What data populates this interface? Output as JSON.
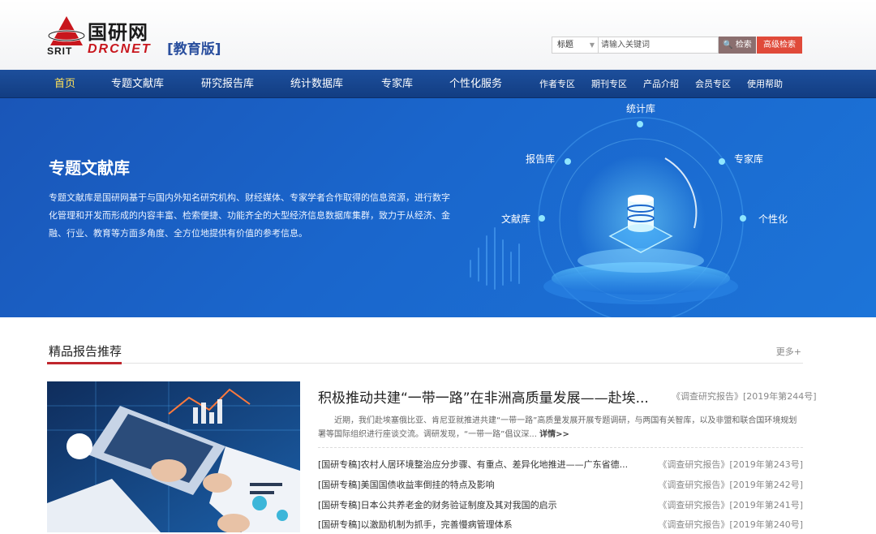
{
  "brand": {
    "name_cn": "国研网",
    "srit": "SRIT",
    "drcnet": "DRCNET",
    "edition": "[教育版]",
    "colors": {
      "brand_red": "#c8161d",
      "nav_blue": "#1a4a95",
      "edition_blue": "#2a4f9e"
    }
  },
  "search": {
    "field_select": "标题",
    "placeholder": "请输入关键词",
    "search_label": "检索",
    "advanced_label": "高级检索"
  },
  "nav": {
    "main": [
      "首页",
      "专题文献库",
      "研究报告库",
      "统计数据库",
      "专家库",
      "个性化服务"
    ],
    "secondary": [
      "作者专区",
      "期刊专区",
      "产品介绍",
      "会员专区",
      "使用帮助"
    ],
    "active_color": "#ffe25a"
  },
  "banner": {
    "title": "专题文献库",
    "description": "专题文献库是国研网基于与国内外知名研究机构、财经媒体、专家学者合作取得的信息资源，进行数字化管理和开发而形成的内容丰富、检索便捷、功能齐全的大型经济信息数据库集群，致力于从经济、金融、行业、教育等方面多角度、全方位地提供有价值的参考信息。",
    "hub_labels": {
      "top": "统计库",
      "upper_left": "报告库",
      "upper_right": "专家库",
      "left": "文献库",
      "right": "个性化"
    }
  },
  "section": {
    "title": "精品报告推荐",
    "more": "更多+"
  },
  "featured": {
    "title": "积极推动共建“一带一路”在非洲高质量发展——赴埃...",
    "source": "《调查研究报告》[2019年第244号]",
    "summary": "近期，我们赴埃塞俄比亚、肯尼亚就推进共建“一带一路”高质量发展开展专题调研，与两国有关智库，以及非盟和联合国环境规划署等国际组织进行座谈交流。调研发现，“一带一路”倡议深...",
    "more": "详情>>"
  },
  "reports": [
    {
      "title": "[国研专稿]农村人居环境整治应分步骤、有重点、差异化地推进——广东省德...",
      "source": "《调查研究报告》[2019年第243号]"
    },
    {
      "title": "[国研专稿]美国国债收益率倒挂的特点及影响",
      "source": "《调查研究报告》[2019年第242号]"
    },
    {
      "title": "[国研专稿]日本公共养老金的财务验证制度及其对我国的启示",
      "source": "《调查研究报告》[2019年第241号]"
    },
    {
      "title": "[国研专稿]以激励机制为抓手，完善慢病管理体系",
      "source": "《调查研究报告》[2019年第240号]"
    }
  ]
}
